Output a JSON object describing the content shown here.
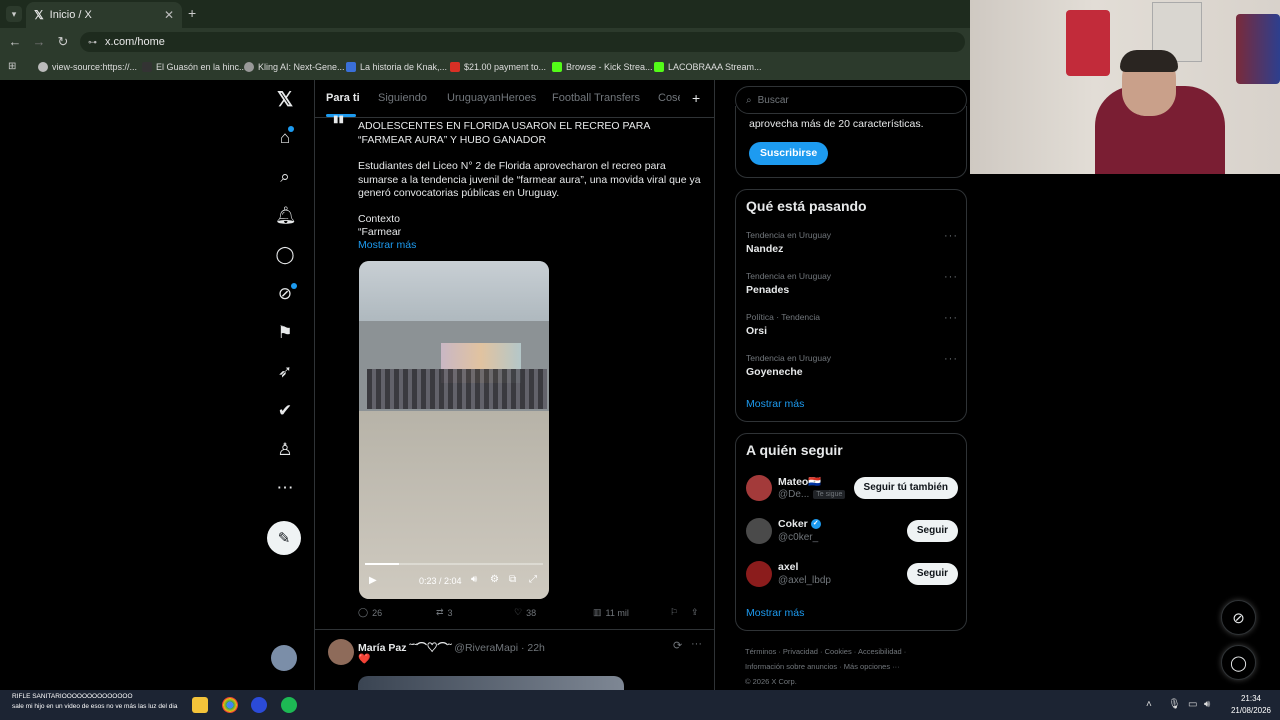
{
  "browser": {
    "tab_title": "Inicio / X",
    "tab_close": "✕",
    "new_tab": "+",
    "url": "x.com/home",
    "bookmarks": [
      {
        "label": "view-source:https://...",
        "color": "#bbbbbb"
      },
      {
        "label": "El Guasón en la hinc...",
        "color": "#333333"
      },
      {
        "label": "Kling AI: Next-Gene...",
        "color": "#999999"
      },
      {
        "label": "La historia de Knak,...",
        "color": "#3a6fd8"
      },
      {
        "label": "$21.00 payment to...",
        "color": "#d93025"
      },
      {
        "label": "Browse - Kick Strea...",
        "color": "#53fc18"
      },
      {
        "label": "LACOBRAAA Stream...",
        "color": "#53fc18"
      }
    ]
  },
  "x": {
    "tabs": [
      "Para ti",
      "Siguiendo",
      "UruguayanHeroes",
      "Football Transfers",
      "Cose"
    ],
    "tabs_plus": "+",
    "post": {
      "headline": "ADOLESCENTES EN FLORIDA USARON EL RECREO PARA “FARMEAR AURA” Y HUBO GANADOR",
      "body": "Estudiantes del Liceo N° 2 de Florida aprovecharon el recreo para sumarse a la tendencia juvenil de “farmear aura”, una movida viral que ya generó convocatorias públicas en Uruguay.",
      "context_label": "Contexto",
      "context_preview": "“Farmear",
      "show_more": "Mostrar más",
      "video_time": "0:23 / 2:04",
      "video_progress": 0.19,
      "replies": "26",
      "reposts": "3",
      "likes": "38",
      "views": "11 mil"
    },
    "post2": {
      "name": "María Paz ˜˜⌒♡⌒˜",
      "handle": "@RiveraMapi",
      "time": "· 22h",
      "emoji": "❤️"
    },
    "search_placeholder": "Buscar",
    "premium": {
      "text": "aprovecha más de 20 características.",
      "button": "Suscribirse"
    },
    "trending": {
      "title": "Qué está pasando",
      "items": [
        {
          "category": "Tendencia en Uruguay",
          "name": "Nandez"
        },
        {
          "category": "Tendencia en Uruguay",
          "name": "Penades"
        },
        {
          "category": "Política · Tendencia",
          "name": "Orsi"
        },
        {
          "category": "Tendencia en Uruguay",
          "name": "Goyeneche"
        }
      ],
      "more": "Mostrar más",
      "dots": "···"
    },
    "who_to_follow": {
      "title": "A quién seguir",
      "items": [
        {
          "name": "Mateo🇵🇾",
          "handle": "@De...",
          "badge": "Te sigue",
          "button": "Seguir tú también",
          "color": "#a33a3a"
        },
        {
          "name": "Coker",
          "handle": "@c0ker_",
          "badge": "",
          "button": "Seguir",
          "color": "#4a4a4a"
        },
        {
          "name": "axel",
          "handle": "@axel_lbdp",
          "badge": "",
          "button": "Seguir",
          "color": "#8b1c1c"
        }
      ],
      "more": "Mostrar más"
    },
    "footer": {
      "line1": "Términos · Privacidad · Cookies · Accesibilidad ·",
      "line2": "Información sobre anuncios · Más opciones ···",
      "line3": "© 2026 X Corp."
    }
  },
  "taskbar": {
    "ticker1": "RIFLE SANITARIOOOOOOOOOOOOOO",
    "ticker2": "sale mi hijo en un video de esos no ve más las luz del dia",
    "time": "21:34",
    "date": "21/08/2026"
  },
  "colors": {
    "accent": "#1d9bf0",
    "background": "#000000",
    "border": "#2f3336",
    "muted_text": "#71767b",
    "browser_chrome": "#2c3a2c"
  }
}
